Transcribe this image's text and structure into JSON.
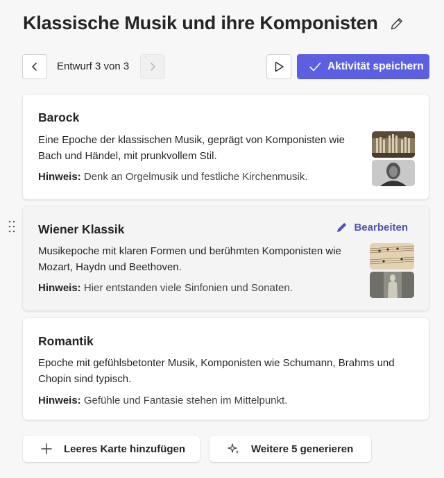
{
  "header": {
    "title": "Klassische Musik und ihre Komponisten",
    "edit_icon": "pencil-icon"
  },
  "navigation": {
    "prev_icon": "chevron-left-icon",
    "draft_label": "Entwurf 3 von 3",
    "next_icon": "chevron-right-icon",
    "play_icon": "play-icon",
    "save_label": "Aktivität speichern",
    "accent": "#5b5fe0"
  },
  "cards": [
    {
      "title": "Barock",
      "desc_line1": "Eine Epoche der klassischen Musik, geprägt von Komponisten wie",
      "desc_line2": "Bach und Händel, mit prunkvollem Stil.",
      "hint_label": "Hinweis:",
      "hint_text": " Denk an Orgelmusik und festliche Kirchenmusik."
    },
    {
      "title": "Wiener Klassik",
      "edit_label": "Bearbeiten",
      "desc_line1": "Musikepoche mit klaren Formen und berühmten Komponisten wie",
      "desc_line2": "Mozart, Haydn und Beethoven.",
      "hint_label": "Hinweis:",
      "hint_text": " Hier entstanden viele Sinfonien und Sonaten."
    },
    {
      "title": "Romantik",
      "desc_line1": "Epoche mit gefühlsbetonter Musik, Komponisten wie Schumann, Brahms und",
      "desc_line2": "Chopin sind typisch.",
      "hint_label": "Hinweis:",
      "hint_text": " Gefühle und Fantasie stehen im Mittelpunkt."
    }
  ],
  "footer": {
    "add_label": "Leeres Karte hinzufügen",
    "generate_label": "Weitere 5 generieren"
  }
}
